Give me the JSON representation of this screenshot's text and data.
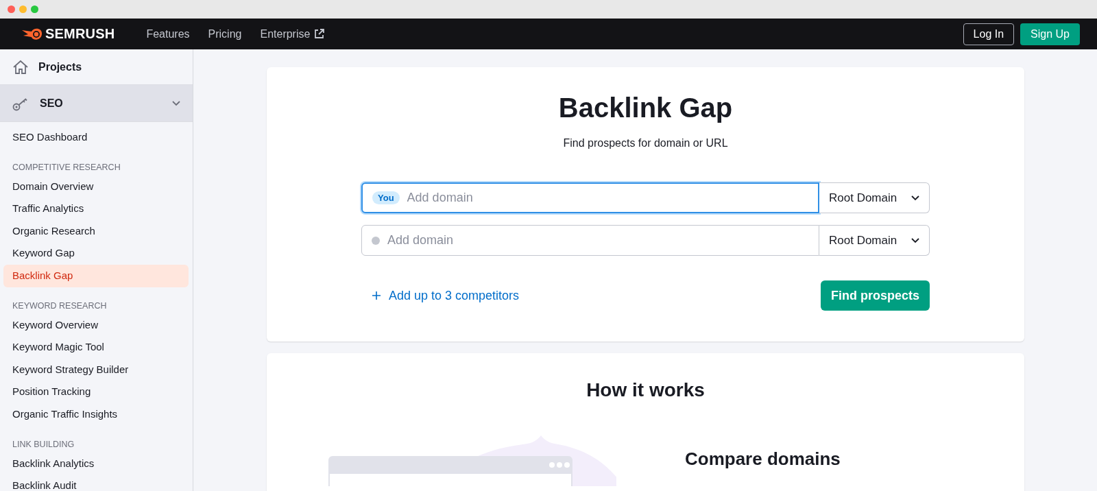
{
  "nav": {
    "logo_text": "SEMRUSH",
    "links": [
      {
        "label": "Features",
        "external": false
      },
      {
        "label": "Pricing",
        "external": false
      },
      {
        "label": "Enterprise",
        "external": true
      }
    ],
    "login": "Log In",
    "signup": "Sign Up"
  },
  "sidebar": {
    "projects": "Projects",
    "section": {
      "label": "SEO",
      "expanded": true
    },
    "groups": [
      {
        "items": [
          {
            "label": "SEO Dashboard",
            "selected": false
          }
        ]
      },
      {
        "heading": "COMPETITIVE RESEARCH",
        "items": [
          {
            "label": "Domain Overview",
            "selected": false
          },
          {
            "label": "Traffic Analytics",
            "selected": false
          },
          {
            "label": "Organic Research",
            "selected": false
          },
          {
            "label": "Keyword Gap",
            "selected": false
          },
          {
            "label": "Backlink Gap",
            "selected": true
          }
        ]
      },
      {
        "heading": "KEYWORD RESEARCH",
        "items": [
          {
            "label": "Keyword Overview",
            "selected": false
          },
          {
            "label": "Keyword Magic Tool",
            "selected": false
          },
          {
            "label": "Keyword Strategy Builder",
            "selected": false
          },
          {
            "label": "Position Tracking",
            "selected": false
          },
          {
            "label": "Organic Traffic Insights",
            "selected": false
          }
        ]
      },
      {
        "heading": "LINK BUILDING",
        "items": [
          {
            "label": "Backlink Analytics",
            "selected": false
          },
          {
            "label": "Backlink Audit",
            "selected": false
          }
        ]
      }
    ]
  },
  "tool": {
    "title": "Backlink Gap",
    "subtitle": "Find prospects for domain or URL",
    "domains": [
      {
        "kind": "you",
        "badge": "You",
        "placeholder": "Add domain",
        "scope": "Root Domain",
        "focused": true
      },
      {
        "kind": "competitor",
        "placeholder": "Add domain",
        "scope": "Root Domain",
        "focused": false
      }
    ],
    "add_link": "Add up to 3 competitors",
    "submit": "Find prospects"
  },
  "how": {
    "title": "How it works",
    "step_title": "Compare domains"
  }
}
